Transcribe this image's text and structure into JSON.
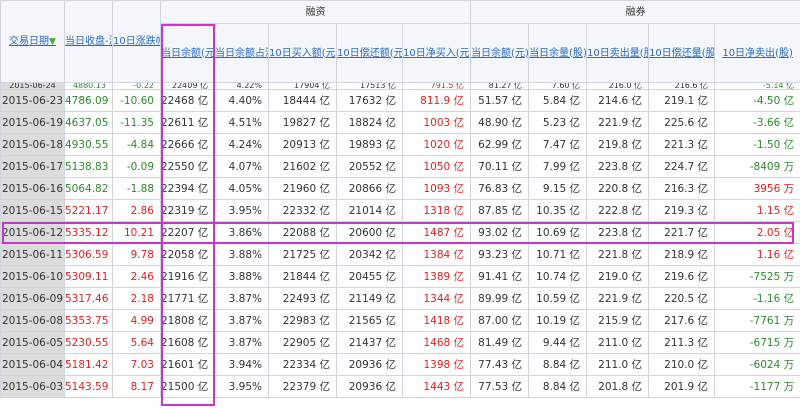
{
  "groups": {
    "financing": "融资",
    "securities": "融券"
  },
  "headers": {
    "date": "交易日期",
    "sort_icon": "arrow-down-icon",
    "close": "当日收盘-沪深300",
    "change": "10日涨跌幅(%)-沪深300",
    "fin_balance": "当日余额(元)",
    "fin_ratio": "当日余额占流通市值比",
    "fin_buy": "10日买入额(元)",
    "fin_repay": "10日偿还额(元)",
    "fin_net": "10日净买入(元)",
    "sec_balance": "当日余额(元)",
    "sec_volume": "当日余量(股)",
    "sec_sell": "10日卖出量(股)",
    "sec_repay": "10日偿还量(股)",
    "sec_net": "10日净卖出(股)"
  },
  "top_partial_row": [
    "2015-06-24",
    "4880.13",
    "-0.22",
    "22409 亿",
    "4.22%",
    "17904 亿",
    "17513 亿",
    "791.5 亿",
    "81.27 亿",
    "7.60 亿",
    "216.0 亿",
    "216.6 亿",
    "-5.14 亿"
  ],
  "rows": [
    [
      "2015-06-23",
      "4786.09",
      "-10.60",
      "22468 亿",
      "4.40%",
      "18444 亿",
      "17632 亿",
      "811.9 亿",
      "51.57 亿",
      "5.84 亿",
      "214.6 亿",
      "219.1 亿",
      "-4.50 亿"
    ],
    [
      "2015-06-19",
      "4637.05",
      "-11.35",
      "22611 亿",
      "4.51%",
      "19827 亿",
      "18824 亿",
      "1003 亿",
      "48.90 亿",
      "5.23 亿",
      "221.9 亿",
      "225.6 亿",
      "-3.66 亿"
    ],
    [
      "2015-06-18",
      "4930.55",
      "-4.84",
      "22666 亿",
      "4.24%",
      "20913 亿",
      "19893 亿",
      "1020 亿",
      "62.99 亿",
      "7.47 亿",
      "219.8 亿",
      "221.3 亿",
      "-1.50 亿"
    ],
    [
      "2015-06-17",
      "5138.83",
      "-0.09",
      "22550 亿",
      "4.07%",
      "21602 亿",
      "20552 亿",
      "1050 亿",
      "70.11 亿",
      "7.99 亿",
      "223.8 亿",
      "224.7 亿",
      "-8409 万"
    ],
    [
      "2015-06-16",
      "5064.82",
      "-1.88",
      "22394 亿",
      "4.05%",
      "21960 亿",
      "20866 亿",
      "1093 亿",
      "76.83 亿",
      "9.15 亿",
      "220.8 亿",
      "216.3 亿",
      "3956 万"
    ],
    [
      "2015-06-15",
      "5221.17",
      "2.86",
      "22319 亿",
      "3.95%",
      "22332 亿",
      "21014 亿",
      "1318 亿",
      "87.85 亿",
      "10.35 亿",
      "222.8 亿",
      "219.3 亿",
      "1.15 亿"
    ],
    [
      "2015-06-12",
      "5335.12",
      "10.21",
      "22207 亿",
      "3.86%",
      "22088 亿",
      "20600 亿",
      "1487 亿",
      "93.02 亿",
      "10.69 亿",
      "223.8 亿",
      "221.7 亿",
      "2.05 亿"
    ],
    [
      "2015-06-11",
      "5306.59",
      "9.78",
      "22058 亿",
      "3.88%",
      "21725 亿",
      "20342 亿",
      "1384 亿",
      "93.23 亿",
      "10.71 亿",
      "221.8 亿",
      "218.9 亿",
      "1.16 亿"
    ],
    [
      "2015-06-10",
      "5309.11",
      "2.46",
      "21916 亿",
      "3.88%",
      "21844 亿",
      "20455 亿",
      "1389 亿",
      "91.41 亿",
      "10.74 亿",
      "219.0 亿",
      "219.6 亿",
      "-7525 万"
    ],
    [
      "2015-06-09",
      "5317.46",
      "2.18",
      "21771 亿",
      "3.87%",
      "22493 亿",
      "21149 亿",
      "1344 亿",
      "89.99 亿",
      "10.59 亿",
      "221.9 亿",
      "220.5 亿",
      "-1.16 亿"
    ],
    [
      "2015-06-08",
      "5353.75",
      "4.99",
      "21808 亿",
      "3.87%",
      "22983 亿",
      "21565 亿",
      "1418 亿",
      "87.00 亿",
      "10.19 亿",
      "215.9 亿",
      "217.6 亿",
      "-7761 万"
    ],
    [
      "2015-06-05",
      "5230.55",
      "5.64",
      "21608 亿",
      "3.87%",
      "22905 亿",
      "21437 亿",
      "1468 亿",
      "81.49 亿",
      "9.44 亿",
      "211.0 亿",
      "211.3 亿",
      "-6715 万"
    ],
    [
      "2015-06-04",
      "5181.42",
      "7.03",
      "21601 亿",
      "3.94%",
      "22334 亿",
      "20936 亿",
      "1398 亿",
      "77.43 亿",
      "8.84 亿",
      "211.0 亿",
      "210.0 亿",
      "-6024 万"
    ],
    [
      "2015-06-03",
      "5143.59",
      "8.17",
      "21500 亿",
      "3.95%",
      "22379 亿",
      "20936 亿",
      "1443 亿",
      "77.53 亿",
      "8.84 亿",
      "201.8 亿",
      "201.9 亿",
      "-1177 万"
    ]
  ],
  "highlight_color": "#cc33cc"
}
